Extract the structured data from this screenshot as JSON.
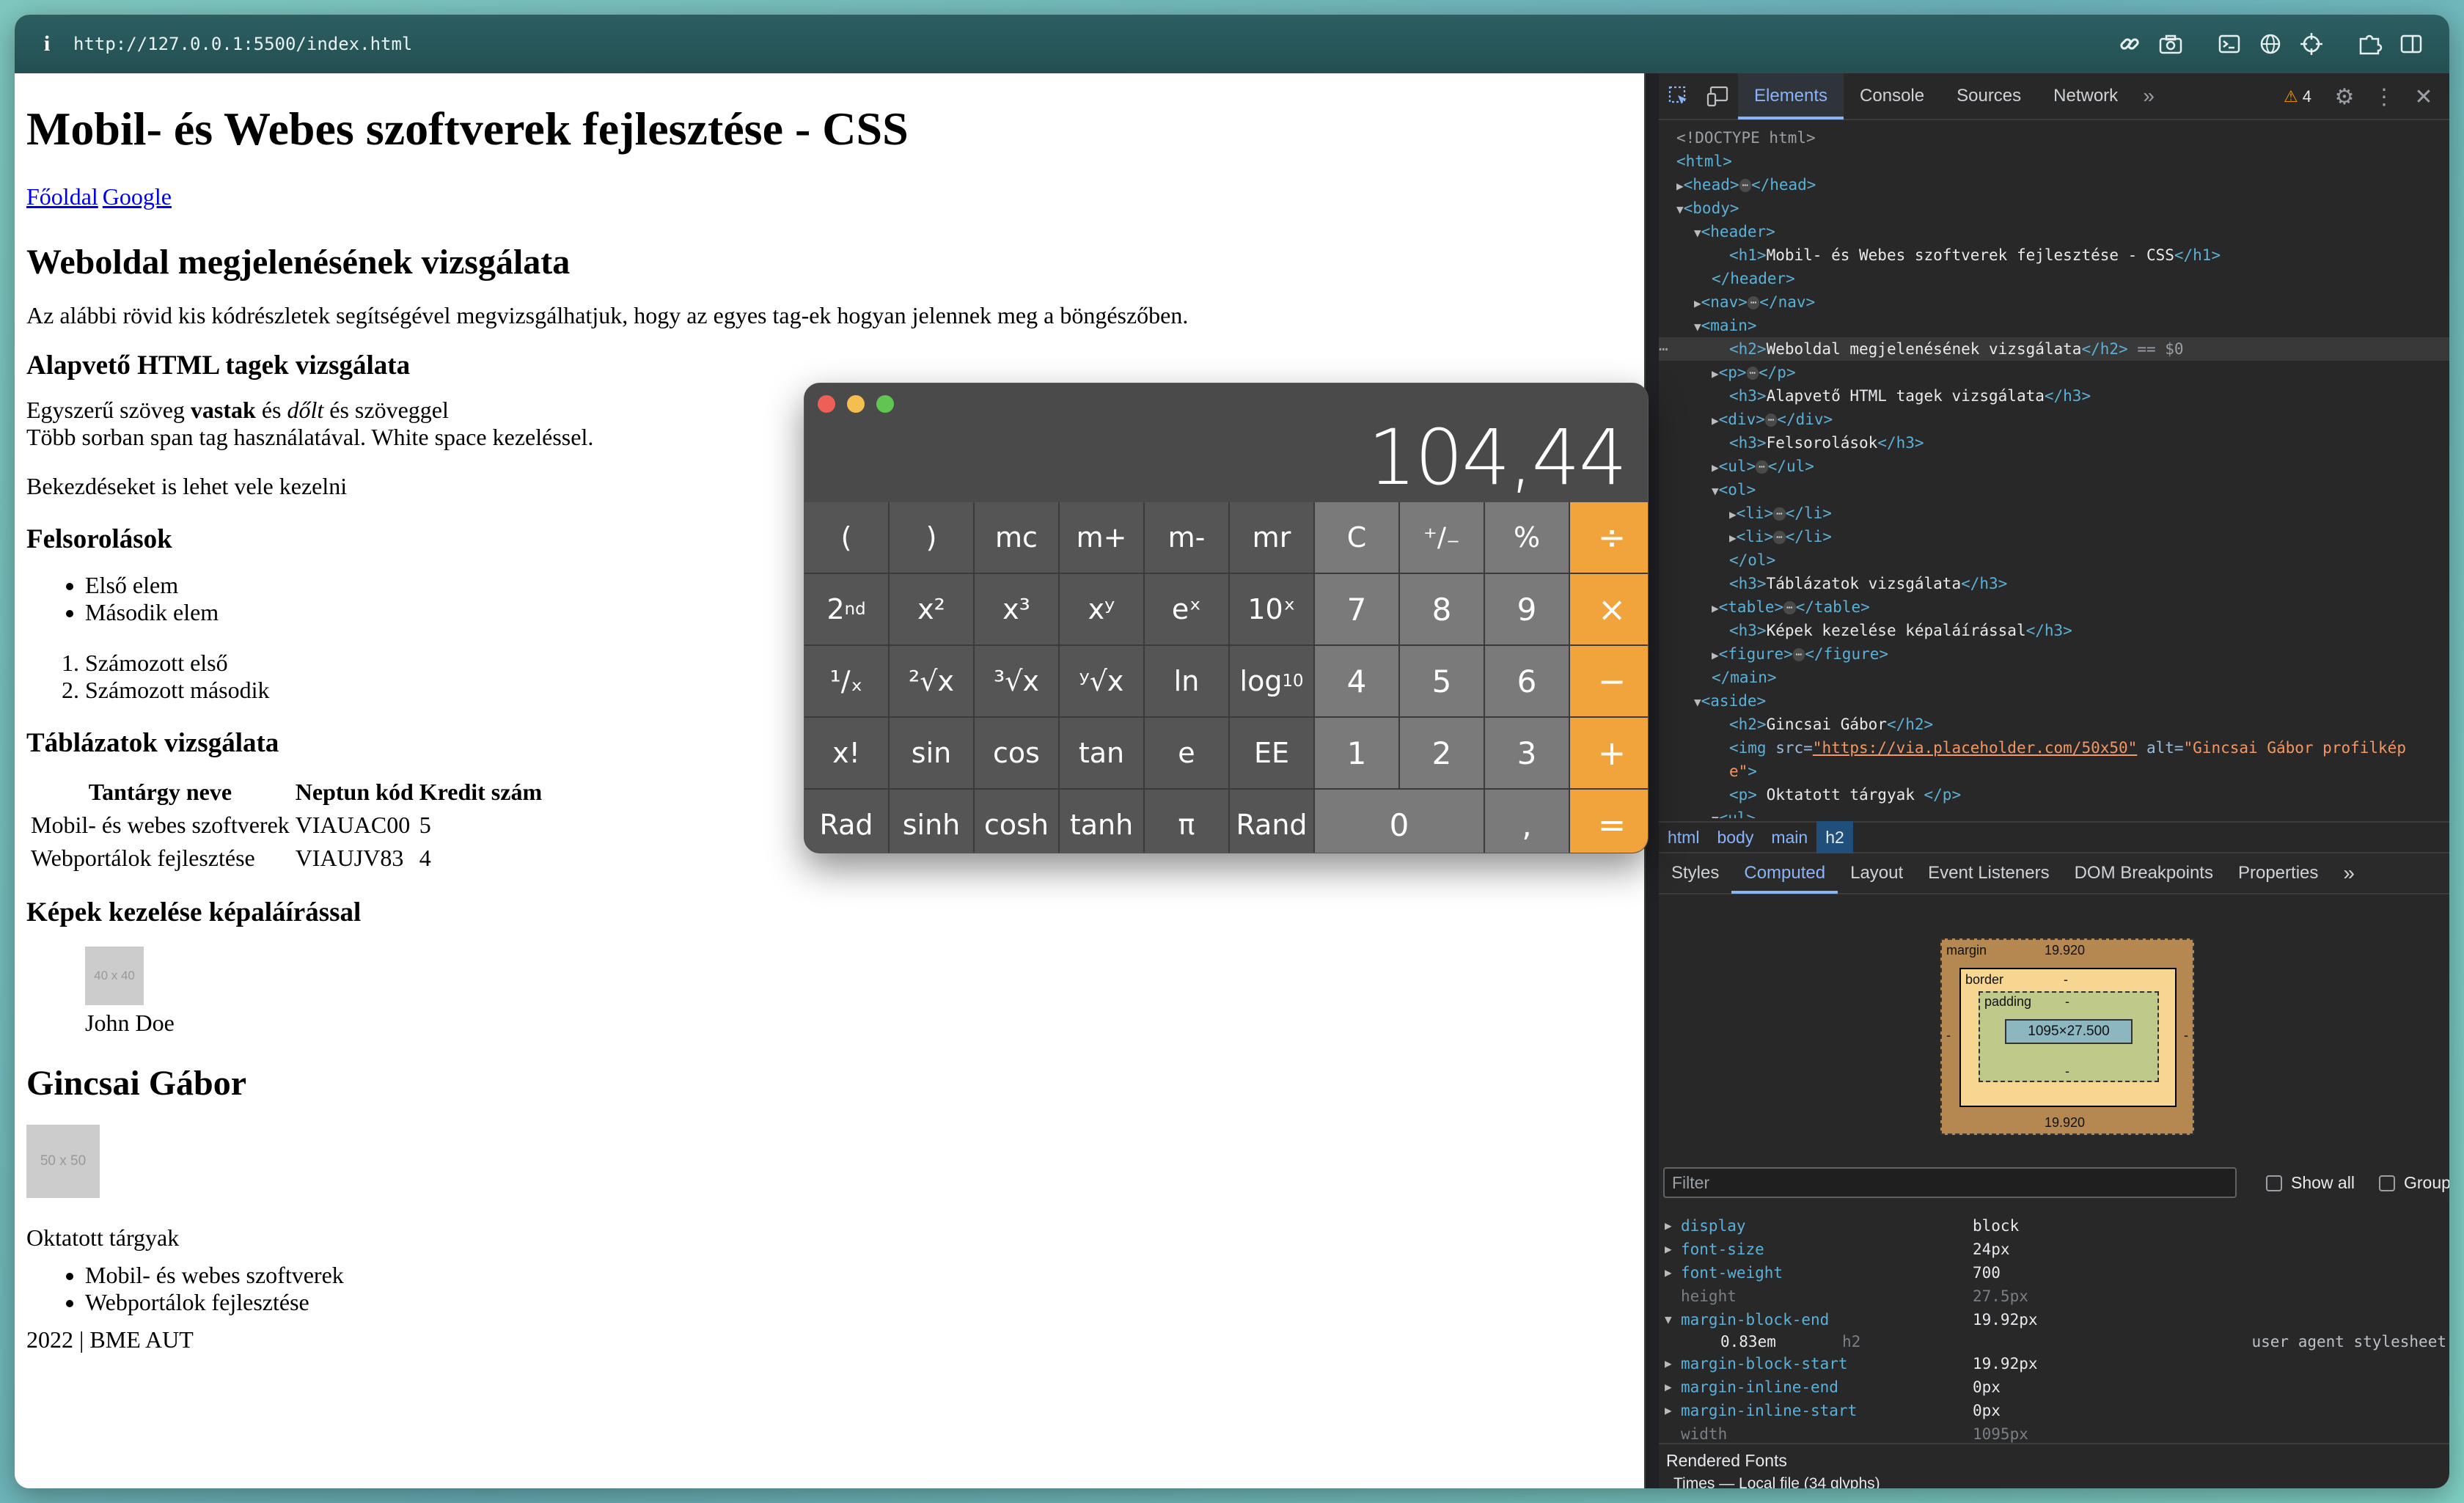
{
  "browser": {
    "url": "http://127.0.0.1:5500/index.html",
    "toolbar_icons": [
      "link-icon",
      "camera-icon",
      "terminal-icon",
      "globe-icon",
      "crosshair-icon",
      "extensions-icon",
      "sidebar-icon"
    ]
  },
  "page": {
    "h1": "Mobil- és Webes szoftverek fejlesztése - CSS",
    "nav": [
      "Főoldal",
      "Google"
    ],
    "section_title": "Weboldal megjelenésének vizsgálata",
    "intro": "Az alábbi rövid kis kódrészletek segítségével megvizsgálhatjuk, hogy az egyes tag-ek hogyan jelennek meg a böngészőben.",
    "h3_basic": "Alapvető HTML tagek vizsgálata",
    "basic_line1_a": "Egyszerű szöveg ",
    "basic_line1_bold": "vastak",
    "basic_line1_b": " és ",
    "basic_line1_italic": "dőlt",
    "basic_line1_c": " és szöveggel",
    "basic_line2": "Több sorban span tag használatával. White space kezeléssel.",
    "basic_para": "Bekezdéseket is lehet vele kezelni",
    "h3_lists": "Felsorolások",
    "ul_items": [
      "Első elem",
      "Második elem"
    ],
    "ol_items": [
      "Számozott első",
      "Számozott második"
    ],
    "h3_tables": "Táblázatok vizsgálata",
    "table_headers": [
      "Tantárgy neve",
      "Neptun kód",
      "Kredit szám"
    ],
    "table_rows": [
      [
        "Mobil- és webes szoftverek",
        "VIAUAC00",
        "5"
      ],
      [
        "Webportálok fejlesztése",
        "VIAUJV83",
        "4"
      ]
    ],
    "h3_images": "Képek kezelése képaláírással",
    "figure_placeholder": "40 x 40",
    "figure_caption": "John Doe",
    "aside_h2": "Gincsai Gábor",
    "aside_placeholder": "50 x 50",
    "aside_subjects_label": "Oktatott tárgyak",
    "aside_subjects": [
      "Mobil- és webes szoftverek",
      "Webportálok fejlesztése"
    ],
    "footer": "2022 | BME AUT"
  },
  "devtools": {
    "tabs": [
      "Elements",
      "Console",
      "Sources",
      "Network"
    ],
    "active_tab": "Elements",
    "warning_count": "4",
    "dom": {
      "doctype": "<!DOCTYPE html>",
      "html": "<html>",
      "head_open": "<head>",
      "head_close": "</head>",
      "body": "<body>",
      "header": "<header>",
      "h1_open": "<h1>",
      "h1_text": "Mobil- és Webes szoftverek fejlesztése - CSS",
      "h1_close": "</h1>",
      "header_close": "</header>",
      "nav_open": "<nav>",
      "nav_close": "</nav>",
      "main": "<main>",
      "h2_open": "<h2>",
      "h2_text": "Weboldal megjelenésének vizsgálata",
      "h2_close": "</h2>",
      "h2_eq": " == $0",
      "p_open": "<p>",
      "p_close": "</p>",
      "h3_open": "<h3>",
      "h3_close": "</h3>",
      "h3_basic": "Alapvető HTML tagek vizsgálata",
      "div_open": "<div>",
      "div_close": "</div>",
      "h3_lists": "Felsorolások",
      "ul_open": "<ul>",
      "ul_close": "</ul>",
      "ol_open": "<ol>",
      "ol_close": "</ol>",
      "li_open": "<li>",
      "li_close": "</li>",
      "h3_tables": "Táblázatok vizsgálata",
      "table_open": "<table>",
      "table_close": "</table>",
      "h3_images": "Képek kezelése képaláírással",
      "figure_open": "<figure>",
      "figure_close": "</figure>",
      "main_close": "</main>",
      "aside": "<aside>",
      "aside_h2_text": "Gincsai Gábor",
      "img_tag": "<img ",
      "img_src_attr": "src=",
      "img_src_val": "\"https://via.placeholder.com/50x50\"",
      "img_alt_attr": " alt=",
      "img_alt_val": "\"Gincsai Gábor profilkép",
      "img_alt_val_cont": "e\"",
      "img_end": ">",
      "aside_p_text": " Oktatott tárgyak ",
      "ul_partial": "<ul>"
    },
    "breadcrumbs": [
      "html",
      "body",
      "main",
      "h2"
    ],
    "sub_tabs": [
      "Styles",
      "Computed",
      "Layout",
      "Event Listeners",
      "DOM Breakpoints",
      "Properties"
    ],
    "active_sub_tab": "Computed",
    "box_model": {
      "margin_label": "margin",
      "margin_top": "19.920",
      "margin_bottom": "19.920",
      "margin_side": "-",
      "border_label": "border",
      "border_value": "-",
      "padding_label": "padding",
      "padding_value": "-",
      "content": "1095×27.500"
    },
    "filter_placeholder": "Filter",
    "show_all": "Show all",
    "group": "Group",
    "properties": [
      {
        "name": "display",
        "value": "block",
        "dim": false,
        "expandable": true
      },
      {
        "name": "font-size",
        "value": "24px",
        "dim": false,
        "expandable": true
      },
      {
        "name": "font-weight",
        "value": "700",
        "dim": false,
        "expandable": true
      },
      {
        "name": "height",
        "value": "27.5px",
        "dim": true,
        "expandable": false
      },
      {
        "name": "margin-block-end",
        "value": "19.92px",
        "dim": false,
        "expandable": true
      },
      {
        "name": "margin-block-start",
        "value": "19.92px",
        "dim": false,
        "expandable": true
      },
      {
        "name": "margin-inline-end",
        "value": "0px",
        "dim": false,
        "expandable": true
      },
      {
        "name": "margin-inline-start",
        "value": "0px",
        "dim": false,
        "expandable": true
      },
      {
        "name": "width",
        "value": "1095px",
        "dim": true,
        "expandable": false
      }
    ],
    "margin_detail": {
      "value": "0.83em",
      "selector": "h2",
      "source": "user agent stylesheet"
    },
    "rendered_fonts": "Rendered Fonts",
    "times_font": "Times — Local file (34 glyphs)"
  },
  "calculator": {
    "display": "104,44",
    "keys": [
      [
        "(",
        ")",
        "mc",
        "m+",
        "m-",
        "mr",
        "C",
        "⁺∕₋",
        "%",
        "÷"
      ],
      [
        "2nd",
        "x²",
        "x³",
        "xʸ",
        "eˣ",
        "10ˣ",
        "7",
        "8",
        "9",
        "×"
      ],
      [
        "¹∕ₓ",
        "²√x",
        "³√x",
        "ʸ√x",
        "ln",
        "log10",
        "4",
        "5",
        "6",
        "−"
      ],
      [
        "x!",
        "sin",
        "cos",
        "tan",
        "e",
        "EE",
        "1",
        "2",
        "3",
        "+"
      ],
      [
        "Rad",
        "sinh",
        "cosh",
        "tanh",
        "π",
        "Rand",
        "0",
        ",",
        "="
      ]
    ],
    "traffic_lights": {
      "close": "#ee5f57",
      "minimize": "#f5bf4f",
      "zoom": "#61c554"
    }
  }
}
